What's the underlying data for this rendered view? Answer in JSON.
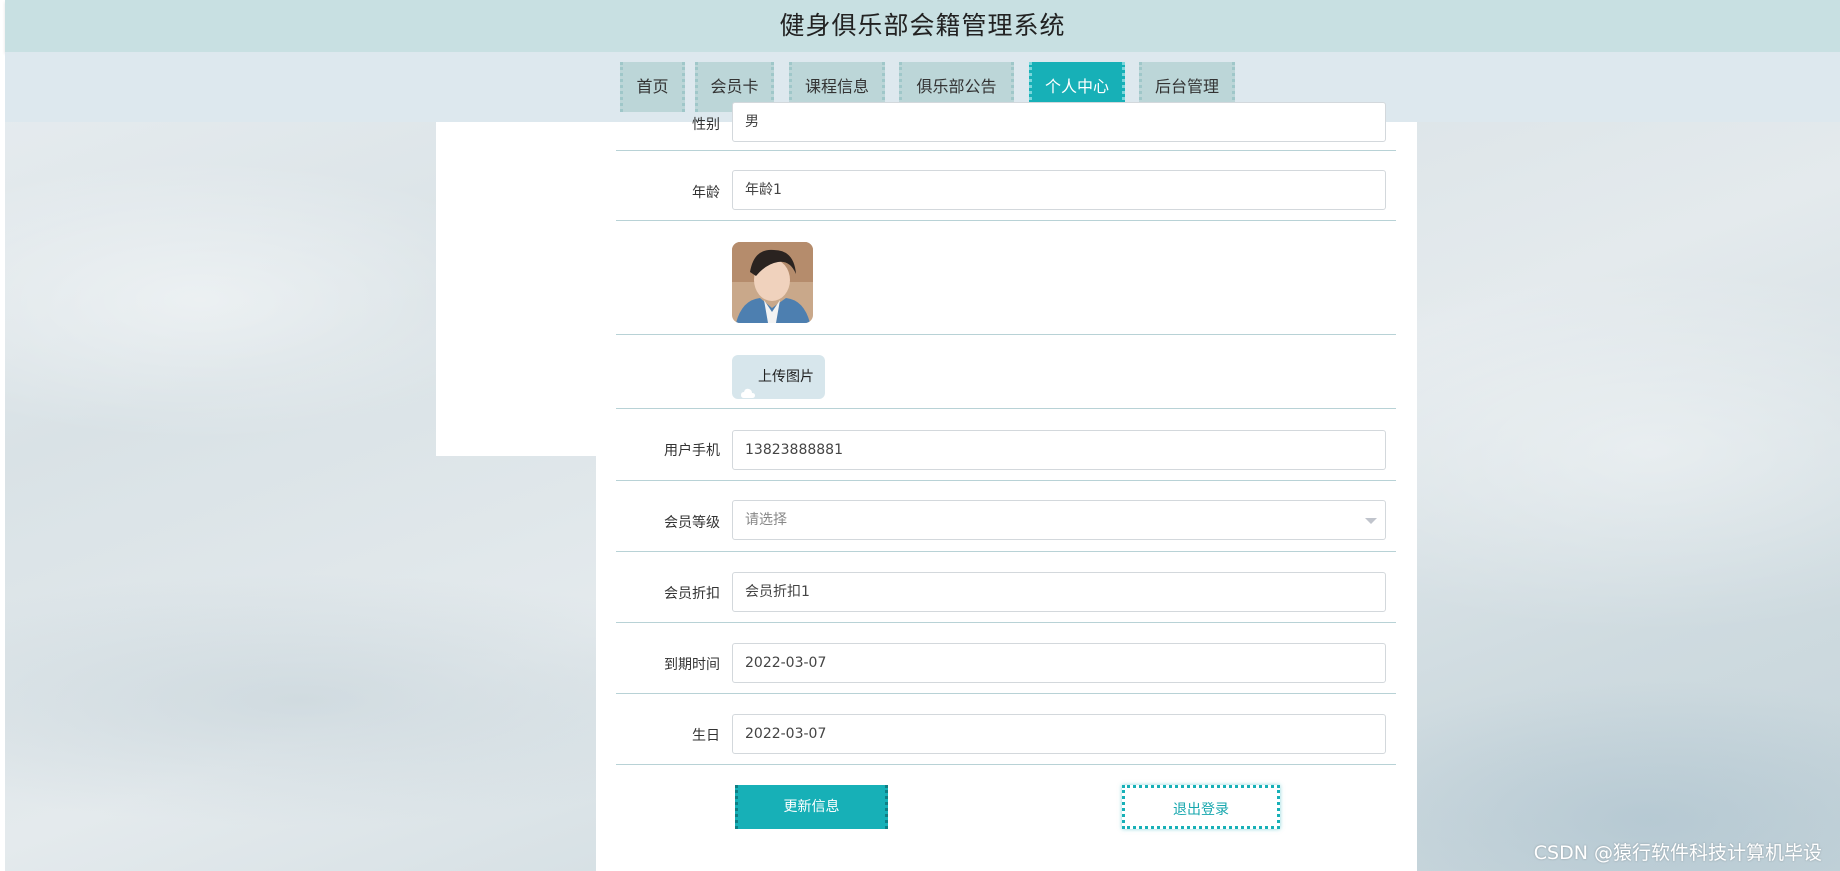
{
  "app": {
    "title": "健身俱乐部会籍管理系统"
  },
  "nav": {
    "items": [
      {
        "label": "首页"
      },
      {
        "label": "会员卡"
      },
      {
        "label": "课程信息"
      },
      {
        "label": "俱乐部公告"
      },
      {
        "label": "个人中心",
        "active": true
      },
      {
        "label": "后台管理"
      }
    ]
  },
  "form": {
    "gender": {
      "label": "性别",
      "value": "男"
    },
    "age": {
      "label": "年龄",
      "value": "年龄1"
    },
    "upload_label": "上传图片",
    "phone": {
      "label": "用户手机",
      "value": "13823888881"
    },
    "level": {
      "label": "会员等级",
      "placeholder": "请选择"
    },
    "discount": {
      "label": "会员折扣",
      "value": "会员折扣1"
    },
    "expire": {
      "label": "到期时间",
      "value": "2022-03-07"
    },
    "birthday": {
      "label": "生日",
      "value": "2022-03-07"
    }
  },
  "buttons": {
    "update": "更新信息",
    "logout": "退出登录"
  },
  "watermark": "CSDN @猿行软件科技计算机毕设",
  "colors": {
    "accent": "#17b0b7",
    "header": "#c8e0e2",
    "nav_item": "#bcd6d8"
  }
}
